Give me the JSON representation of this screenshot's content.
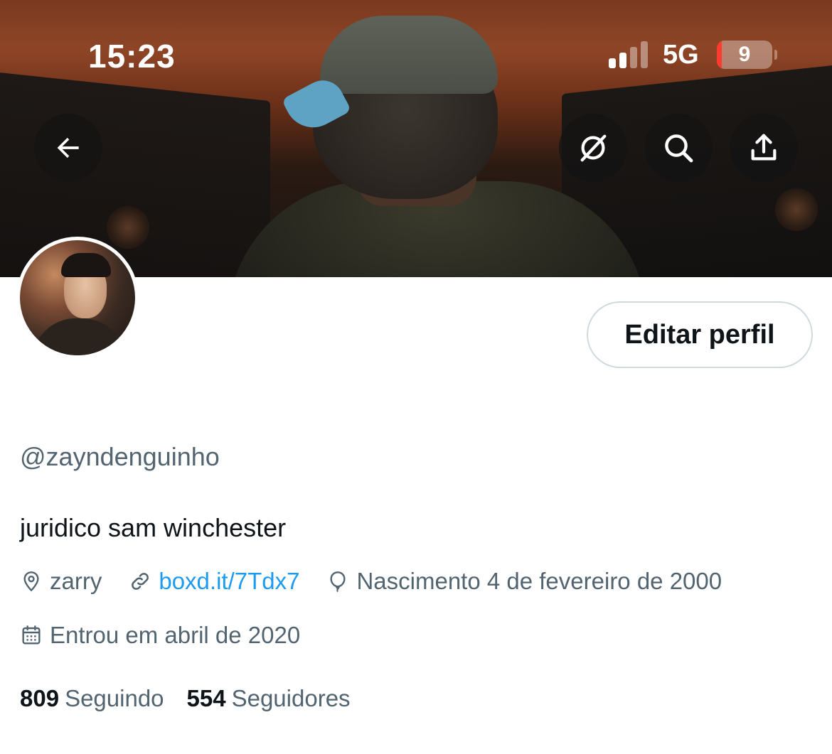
{
  "status_bar": {
    "time": "15:23",
    "network": "5G",
    "battery_level": "9",
    "battery_fraction": 0.09,
    "signal_bars_active": 2,
    "signal_bars_total": 4
  },
  "header_actions": {
    "back_icon": "arrow-left-icon",
    "grok_icon": "grok-slash-icon",
    "search_icon": "search-icon",
    "share_icon": "share-upload-icon"
  },
  "profile": {
    "edit_button_label": "Editar perfil",
    "handle": "@zayndenguinho",
    "bio": "juridico sam winchester",
    "location": "zarry",
    "website": "boxd.it/7Tdx7",
    "birthday": "Nascimento 4 de fevereiro de 2000",
    "joined": "Entrou em abril de 2020"
  },
  "stats": {
    "following_count": "809",
    "following_label": "Seguindo",
    "followers_count": "554",
    "followers_label": "Seguidores"
  },
  "colors": {
    "text_primary": "#0f1419",
    "text_secondary": "#536471",
    "link": "#1d9bf0",
    "button_border": "#cfd9de",
    "battery_low": "#ff3b30"
  }
}
